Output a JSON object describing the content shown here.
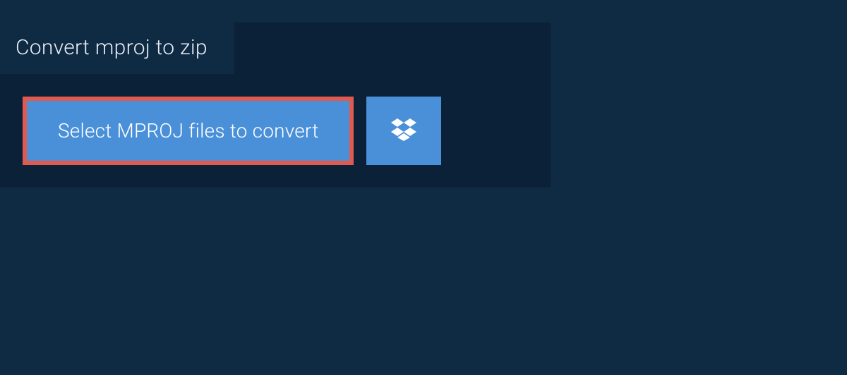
{
  "tab": {
    "title": "Convert mproj to zip"
  },
  "actions": {
    "select_label": "Select MPROJ files to convert"
  }
}
